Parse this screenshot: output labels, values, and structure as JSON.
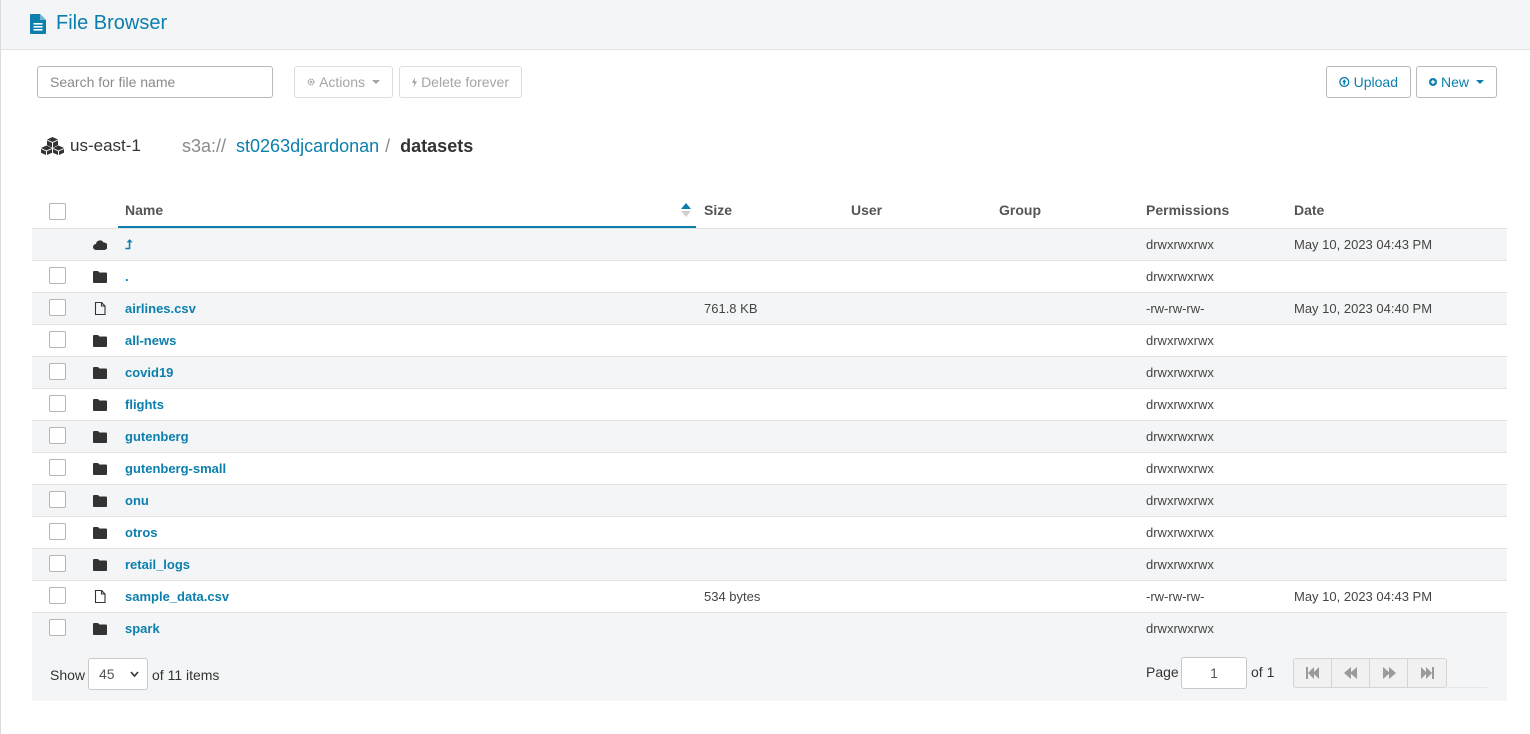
{
  "app": {
    "title": "File Browser"
  },
  "toolbar": {
    "search_placeholder": "Search for file name",
    "actions_label": "Actions",
    "delete_label": "Delete forever",
    "upload_label": "Upload",
    "new_label": "New"
  },
  "location": {
    "region": "us-east-1",
    "scheme": "s3a://",
    "bucket": "st0263djcardonan",
    "separator": "/",
    "current": "datasets"
  },
  "table": {
    "columns": {
      "name": "Name",
      "size": "Size",
      "user": "User",
      "group": "Group",
      "permissions": "Permissions",
      "date": "Date"
    },
    "sort": {
      "column": "Name",
      "direction": "ascending"
    },
    "rows": [
      {
        "icon": "cloud-icon",
        "name": "⮥",
        "size": "",
        "permissions": "drwxrwxrwx",
        "date": "May 10, 2023 04:43 PM",
        "checkbox": false
      },
      {
        "icon": "folder-icon",
        "name": ".",
        "size": "",
        "permissions": "drwxrwxrwx",
        "date": "",
        "checkbox": true
      },
      {
        "icon": "file-icon",
        "name": "airlines.csv",
        "size": "761.8 KB",
        "permissions": "-rw-rw-rw-",
        "date": "May 10, 2023 04:40 PM",
        "checkbox": true
      },
      {
        "icon": "folder-icon",
        "name": "all-news",
        "size": "",
        "permissions": "drwxrwxrwx",
        "date": "",
        "checkbox": true
      },
      {
        "icon": "folder-icon",
        "name": "covid19",
        "size": "",
        "permissions": "drwxrwxrwx",
        "date": "",
        "checkbox": true
      },
      {
        "icon": "folder-icon",
        "name": "flights",
        "size": "",
        "permissions": "drwxrwxrwx",
        "date": "",
        "checkbox": true
      },
      {
        "icon": "folder-icon",
        "name": "gutenberg",
        "size": "",
        "permissions": "drwxrwxrwx",
        "date": "",
        "checkbox": true
      },
      {
        "icon": "folder-icon",
        "name": "gutenberg-small",
        "size": "",
        "permissions": "drwxrwxrwx",
        "date": "",
        "checkbox": true
      },
      {
        "icon": "folder-icon",
        "name": "onu",
        "size": "",
        "permissions": "drwxrwxrwx",
        "date": "",
        "checkbox": true
      },
      {
        "icon": "folder-icon",
        "name": "otros",
        "size": "",
        "permissions": "drwxrwxrwx",
        "date": "",
        "checkbox": true
      },
      {
        "icon": "folder-icon",
        "name": "retail_logs",
        "size": "",
        "permissions": "drwxrwxrwx",
        "date": "",
        "checkbox": true
      },
      {
        "icon": "file-icon",
        "name": "sample_data.csv",
        "size": "534 bytes",
        "permissions": "-rw-rw-rw-",
        "date": "May 10, 2023 04:43 PM",
        "checkbox": true
      },
      {
        "icon": "folder-icon",
        "name": "spark",
        "size": "",
        "permissions": "drwxrwxrwx",
        "date": "",
        "checkbox": true
      }
    ]
  },
  "footer": {
    "show_label": "Show",
    "page_size": "45",
    "of_items": "of 11 items",
    "page_label": "Page",
    "page_value": "1",
    "of_pages": "of 1"
  },
  "colors": {
    "accent": "#0B7FAD",
    "row_alt": "#f4f5f6"
  }
}
